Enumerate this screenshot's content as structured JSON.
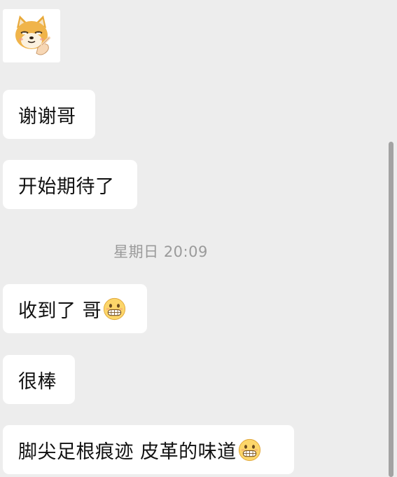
{
  "sticker": {
    "icon": "shiba-dog-sticker"
  },
  "messages": [
    {
      "text": "谢谢哥",
      "emoji": ""
    },
    {
      "text": "开始期待了",
      "emoji": ""
    }
  ],
  "timestamp": "星期日 20:09",
  "messages_after": [
    {
      "text": "收到了 哥",
      "emoji": "grinning-face-icon"
    },
    {
      "text": "很棒",
      "emoji": ""
    },
    {
      "text": "脚尖足根痕迹 皮革的味道",
      "emoji": "grinning-face-icon"
    }
  ],
  "colors": {
    "background": "#ededed",
    "bubble": "#ffffff",
    "text": "#111111",
    "timestamp": "#9a9a9a",
    "scrollbar": "#a3a3a3"
  }
}
